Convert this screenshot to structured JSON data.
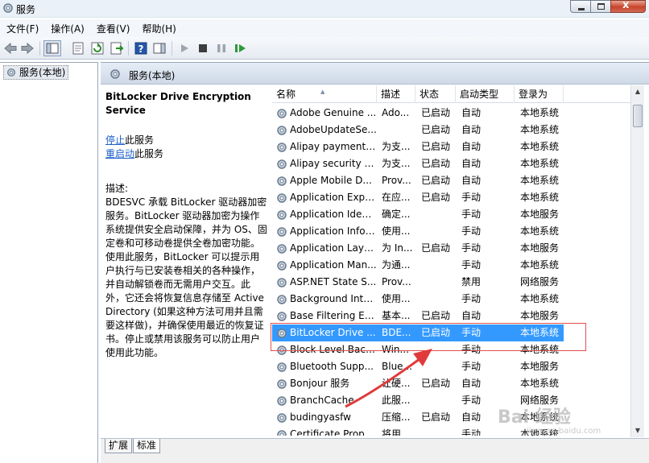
{
  "window": {
    "title": "服务"
  },
  "menu": [
    "文件(F)",
    "操作(A)",
    "查看(V)",
    "帮助(H)"
  ],
  "tree": {
    "root_label": "服务(本地)"
  },
  "pane": {
    "header": "服务(本地)",
    "service_title": "BitLocker Drive Encryption Service",
    "link_stop": "停止",
    "link_stop_suffix": "此服务",
    "link_restart": "重启动",
    "link_restart_suffix": "此服务",
    "desc_label": "描述:",
    "desc_text": "BDESVC 承载 BitLocker 驱动器加密服务。BitLocker 驱动器加密为操作系统提供安全启动保障，并为 OS、固定卷和可移动卷提供全卷加密功能。使用此服务，BitLocker 可以提示用户执行与已安装卷相关的各种操作，并自动解锁卷而无需用户交互。此外，它还会将恢复信息存储至 Active Directory (如果这种方法可用并且需要这样做)，并确保使用最近的恢复证书。停止或禁用该服务可以防止用户使用此功能。"
  },
  "columns": [
    "名称",
    "描述",
    "状态",
    "启动类型",
    "登录为"
  ],
  "rows": [
    [
      "Adobe Genuine ...",
      "Ado...",
      "已启动",
      "自动",
      "本地系统"
    ],
    [
      "AdobeUpdateSe...",
      "",
      "已启动",
      "自动",
      "本地系统"
    ],
    [
      "Alipay payment ...",
      "为支...",
      "已启动",
      "自动",
      "本地系统"
    ],
    [
      "Alipay security b...",
      "为支...",
      "已启动",
      "自动",
      "本地系统"
    ],
    [
      "Apple Mobile D...",
      "Prov...",
      "已启动",
      "自动",
      "本地系统"
    ],
    [
      "Application Expe...",
      "在应...",
      "已启动",
      "手动",
      "本地系统"
    ],
    [
      "Application Iden...",
      "确定...",
      "",
      "手动",
      "本地服务"
    ],
    [
      "Application Infor...",
      "使用...",
      "",
      "手动",
      "本地系统"
    ],
    [
      "Application Laye...",
      "为 In...",
      "已启动",
      "手动",
      "本地服务"
    ],
    [
      "Application Man...",
      "为通...",
      "",
      "手动",
      "本地系统"
    ],
    [
      "ASP.NET State S...",
      "Prov...",
      "",
      "禁用",
      "网络服务"
    ],
    [
      "Background Inte...",
      "使用...",
      "",
      "手动",
      "本地系统"
    ],
    [
      "Base Filtering En...",
      "基本...",
      "已启动",
      "自动",
      "本地服务"
    ],
    [
      "BitLocker Drive ...",
      "BDE...",
      "已启动",
      "手动",
      "本地系统"
    ],
    [
      "Block Level Back...",
      "Win...",
      "",
      "手动",
      "本地系统"
    ],
    [
      "Bluetooth Supp...",
      "Blue...",
      "",
      "手动",
      "本地服务"
    ],
    [
      "Bonjour 服务",
      "让硬...",
      "已启动",
      "自动",
      "本地系统"
    ],
    [
      "BranchCache",
      "此服...",
      "",
      "手动",
      "网络服务"
    ],
    [
      "budingyasfw",
      "压缩...",
      "已启动",
      "自动",
      "本地系统"
    ],
    [
      "Certificate Propa...",
      "将用...",
      "",
      "手动",
      "本地系统"
    ]
  ],
  "selected_row": 13,
  "tabs": [
    "扩展",
    "标准"
  ],
  "watermark": {
    "text": "Bai 经验",
    "sub": "jingyan.baidu.com"
  },
  "colors": {
    "selection": "#3399ff",
    "link": "#1c5fc8",
    "annotation": "#e05050"
  }
}
